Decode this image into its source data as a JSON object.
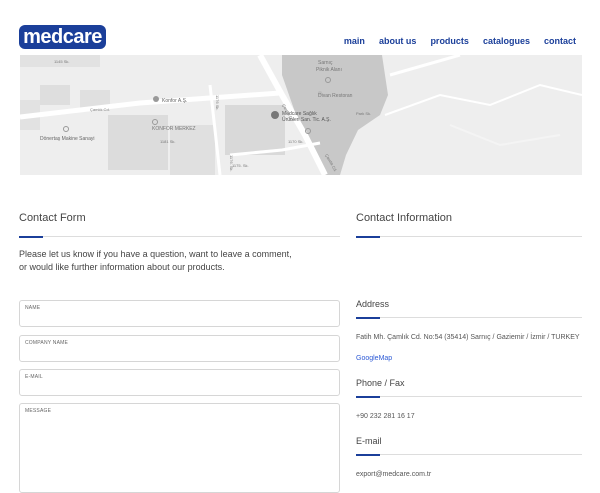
{
  "brand": {
    "logo_text": "medcare"
  },
  "nav": [
    {
      "label": "main"
    },
    {
      "label": "about us"
    },
    {
      "label": "products"
    },
    {
      "label": "catalogues"
    },
    {
      "label": "contact"
    }
  ],
  "map": {
    "labels": {
      "sarnic": "Sarnıç",
      "piknik": "Piknik Alanı",
      "divan": "Divan Restoran",
      "konfor": "Konfor A.Ş.",
      "konfor_merkez": "KONFOR MERKEZ",
      "medcare_line1": "Medcare Sağlık",
      "medcare_line2": "Ürünleri San. Tic. A.Ş.",
      "donertas": "Dönertaş Makine Sanayi",
      "camlik": "Çamlık Cd.",
      "camlik_cd": "Çamlık Cd",
      "camlik_cd2": "Çamlık Cd.",
      "sk1": "1145 Sk.",
      "sk2": "1176 Sk.",
      "sk3": "1176. Sk.",
      "sk4": "1170 Sk.",
      "sk5": "1175. Sk.",
      "sk6": "1181 Sk.",
      "sk7": "Park Sk."
    }
  },
  "contact_form": {
    "title": "Contact Form",
    "intro_line1": "Please let us know if you have a question, want to leave a comment,",
    "intro_line2": "or would like further information about our products.",
    "fields": {
      "name": "NAME",
      "company": "COMPANY NAME",
      "email": "E-MAIL",
      "message": "MESSAGE"
    }
  },
  "contact_info": {
    "title": "Contact Information",
    "address_title": "Address",
    "address_text": "Fatih Mh. Çamlık Cd. No:54 (35414) Sarnıç / Gaziemir / İzmir / TURKEY",
    "map_link": "GoogleMap",
    "phone_title": "Phone / Fax",
    "phone_text": "+90 232 281 16 17",
    "email_title": "E-mail",
    "email_text": "export@medcare.com.tr"
  },
  "colors": {
    "brand": "#1b3f9a",
    "link": "#2e5bd6"
  }
}
